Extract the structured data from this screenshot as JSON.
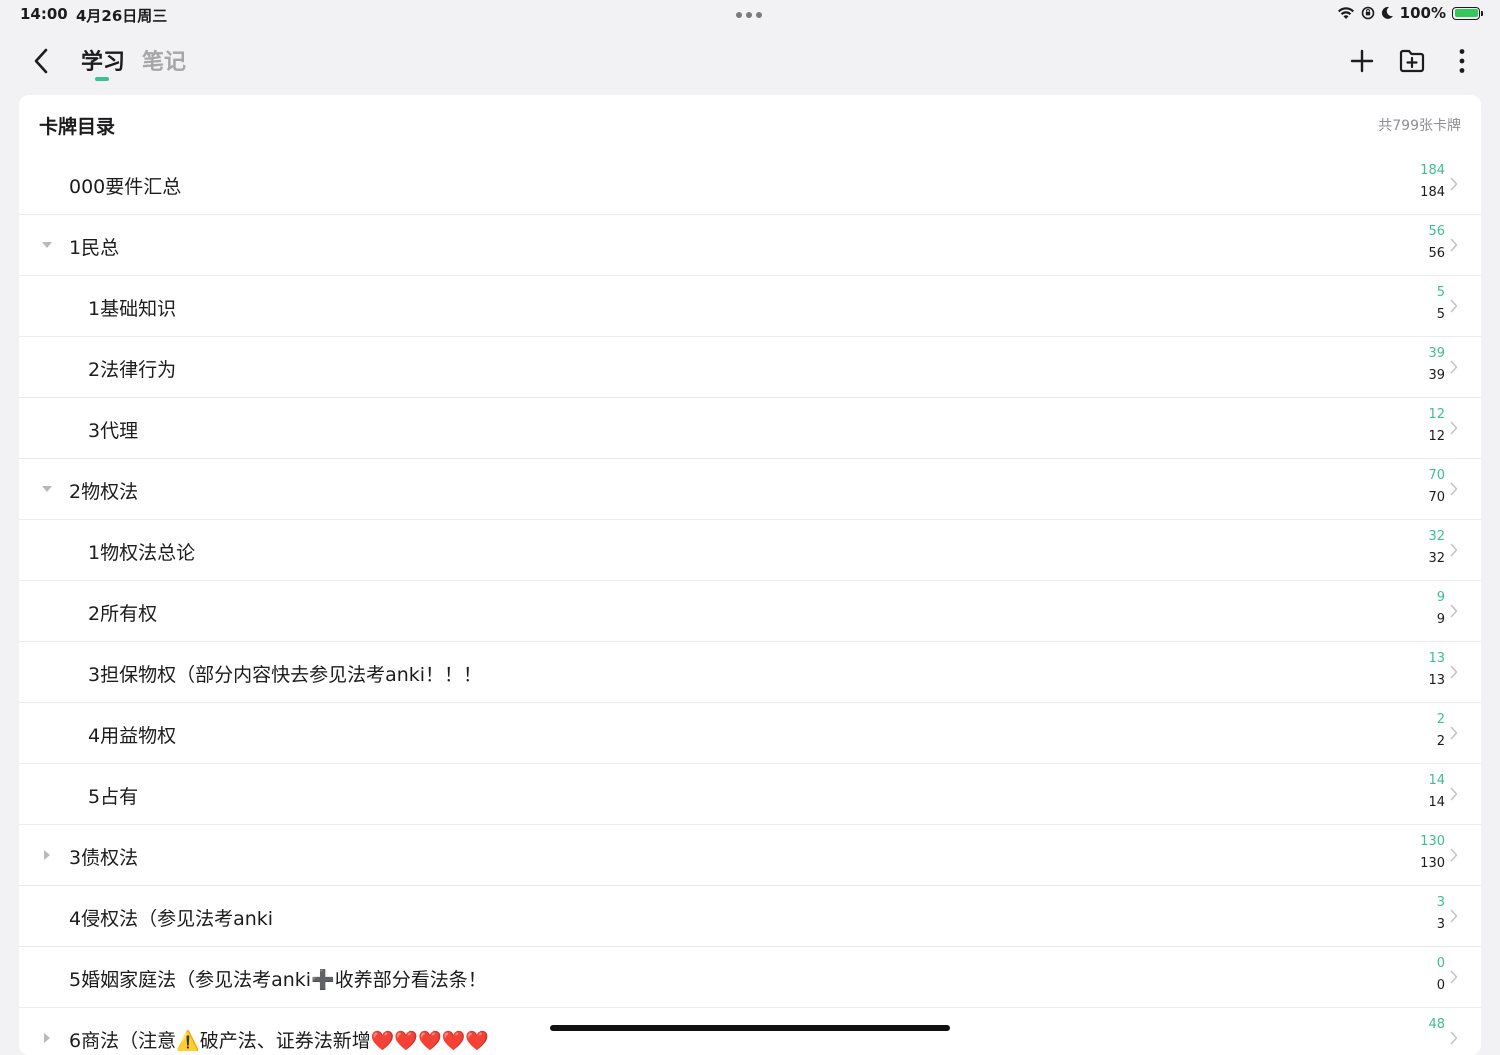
{
  "status_bar": {
    "time": "14:00",
    "date": "4月26日周三",
    "battery": "100%",
    "icons": [
      "wifi-icon",
      "orientation-lock-icon",
      "moon-icon",
      "battery-icon"
    ]
  },
  "nav": {
    "tabs": [
      {
        "label": "学习",
        "active": true
      },
      {
        "label": "笔记",
        "active": false
      }
    ],
    "actions": [
      "add-icon",
      "new-folder-icon",
      "more-icon"
    ],
    "accent_color": "#3dbf8f"
  },
  "catalog": {
    "title": "卡牌目录",
    "total": "共799张卡牌",
    "rows": [
      {
        "label": "000要件汇总",
        "level": 0,
        "toggle": "none",
        "new": "184",
        "total": "184"
      },
      {
        "label": "1民总",
        "level": 0,
        "toggle": "expanded",
        "new": "56",
        "total": "56"
      },
      {
        "label": "1基础知识",
        "level": 1,
        "toggle": "none",
        "new": "5",
        "total": "5"
      },
      {
        "label": "2法律行为",
        "level": 1,
        "toggle": "none",
        "new": "39",
        "total": "39"
      },
      {
        "label": "3代理",
        "level": 1,
        "toggle": "none",
        "new": "12",
        "total": "12"
      },
      {
        "label": "2物权法",
        "level": 0,
        "toggle": "expanded",
        "new": "70",
        "total": "70"
      },
      {
        "label": "1物权法总论",
        "level": 1,
        "toggle": "none",
        "new": "32",
        "total": "32"
      },
      {
        "label": "2所有权",
        "level": 1,
        "toggle": "none",
        "new": "9",
        "total": "9"
      },
      {
        "label": "3担保物权（部分内容快去参见法考anki！！！",
        "level": 1,
        "toggle": "none",
        "new": "13",
        "total": "13"
      },
      {
        "label": "4用益物权",
        "level": 1,
        "toggle": "none",
        "new": "2",
        "total": "2"
      },
      {
        "label": "5占有",
        "level": 1,
        "toggle": "none",
        "new": "14",
        "total": "14"
      },
      {
        "label": "3债权法",
        "level": 0,
        "toggle": "collapsed",
        "new": "130",
        "total": "130"
      },
      {
        "label": "4侵权法（参见法考anki",
        "level": 0,
        "toggle": "none",
        "new": "3",
        "total": "3"
      },
      {
        "label": "5婚姻家庭法（参见法考anki➕收养部分看法条！",
        "level": 0,
        "toggle": "none",
        "new": "0",
        "total": "0"
      },
      {
        "label": "6商法（注意⚠️破产法、证券法新增❤️❤️❤️❤️❤️",
        "level": 0,
        "toggle": "collapsed",
        "new": "48",
        "total": ""
      }
    ]
  }
}
